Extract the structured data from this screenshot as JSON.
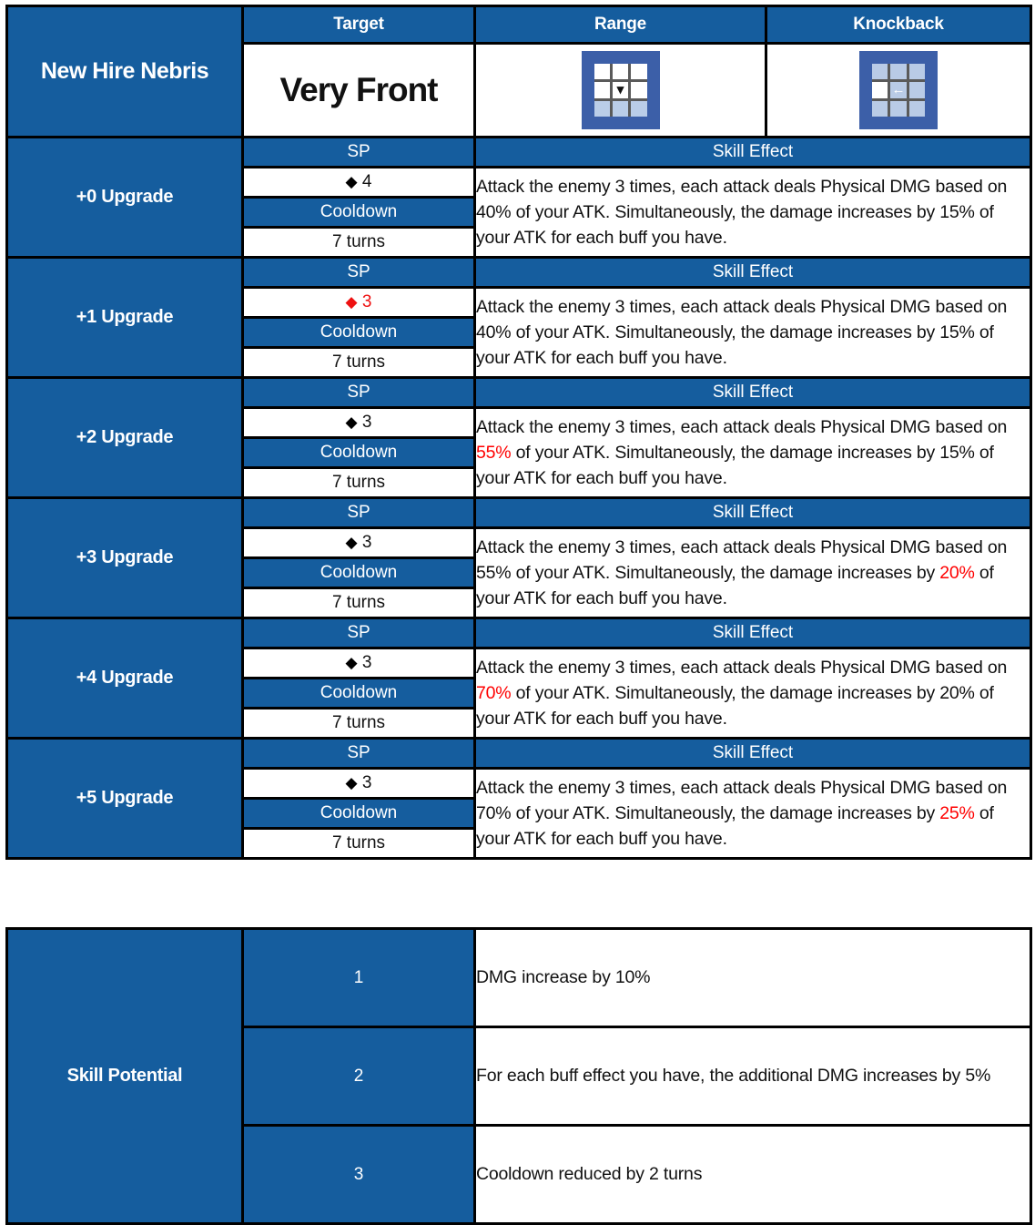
{
  "character": {
    "name": "New Hire Nebris"
  },
  "headers": {
    "target": "Target",
    "range": "Range",
    "knockback": "Knockback"
  },
  "summary": {
    "target_value": "Very Front",
    "range_icon": "range-grid-down-icon",
    "knockback_icon": "knockback-grid-left-arrow-icon"
  },
  "labels": {
    "sp": "SP",
    "cooldown": "Cooldown",
    "skill_effect": "Skill Effect"
  },
  "colors": {
    "blue": "#155D9E",
    "highlight_red": "#FF0000",
    "border": "#000000",
    "icon_frame": "#3C5FA8"
  },
  "upgrades": [
    {
      "name": "+0 Upgrade",
      "sp_value": "4",
      "sp_diamond_color": "black",
      "cooldown_value": "7 turns",
      "effect": {
        "part1": "Attack the enemy 3 times, each attack deals Physical DMG based on ",
        "dmg_pct": "40%",
        "dmg_pct_highlighted": false,
        "part2": " of your ATK. Simultaneously, the damage increases by ",
        "buff_pct": "15%",
        "buff_pct_highlighted": false,
        "part3": " of your ATK for each buff you have."
      }
    },
    {
      "name": "+1 Upgrade",
      "sp_value": "3",
      "sp_diamond_color": "red",
      "cooldown_value": "7 turns",
      "effect": {
        "part1": "Attack the enemy 3 times, each attack deals Physical DMG based on ",
        "dmg_pct": "40%",
        "dmg_pct_highlighted": false,
        "part2": " of your ATK. Simultaneously, the damage increases by ",
        "buff_pct": "15%",
        "buff_pct_highlighted": false,
        "part3": " of your ATK for each buff you have."
      }
    },
    {
      "name": "+2 Upgrade",
      "sp_value": "3",
      "sp_diamond_color": "black",
      "cooldown_value": "7 turns",
      "effect": {
        "part1": "Attack the enemy 3 times, each attack deals Physical DMG based on ",
        "dmg_pct": "55%",
        "dmg_pct_highlighted": true,
        "part2": " of your ATK. Simultaneously, the damage increases by ",
        "buff_pct": "15%",
        "buff_pct_highlighted": false,
        "part3": " of your ATK for each buff you have."
      }
    },
    {
      "name": "+3 Upgrade",
      "sp_value": "3",
      "sp_diamond_color": "black",
      "cooldown_value": "7 turns",
      "effect": {
        "part1": "Attack the enemy 3 times, each attack deals Physical DMG based on ",
        "dmg_pct": "55%",
        "dmg_pct_highlighted": false,
        "part2": " of your ATK. Simultaneously, the damage increases by ",
        "buff_pct": "20%",
        "buff_pct_highlighted": true,
        "part3": " of your ATK for each buff you have."
      }
    },
    {
      "name": "+4 Upgrade",
      "sp_value": "3",
      "sp_diamond_color": "black",
      "cooldown_value": "7 turns",
      "effect": {
        "part1": "Attack the enemy 3 times, each attack deals Physical DMG based on ",
        "dmg_pct": "70%",
        "dmg_pct_highlighted": true,
        "part2": " of your ATK. Simultaneously, the damage increases by ",
        "buff_pct": "20%",
        "buff_pct_highlighted": false,
        "part3": " of your ATK for each buff you have."
      }
    },
    {
      "name": "+5 Upgrade",
      "sp_value": "3",
      "sp_diamond_color": "black",
      "cooldown_value": "7 turns",
      "effect": {
        "part1": "Attack the enemy 3 times, each attack deals Physical DMG based on ",
        "dmg_pct": "70%",
        "dmg_pct_highlighted": false,
        "part2": " of your ATK. Simultaneously, the damage increases by ",
        "buff_pct": "25%",
        "buff_pct_highlighted": true,
        "part3": " of your ATK for each buff you have."
      }
    }
  ],
  "potential": {
    "label": "Skill Potential",
    "rows": [
      {
        "level": "1",
        "description": "DMG increase by 10%"
      },
      {
        "level": "2",
        "description": "For each buff effect you have, the additional DMG increases by 5%"
      },
      {
        "level": "3",
        "description": "Cooldown reduced by 2 turns"
      }
    ]
  }
}
